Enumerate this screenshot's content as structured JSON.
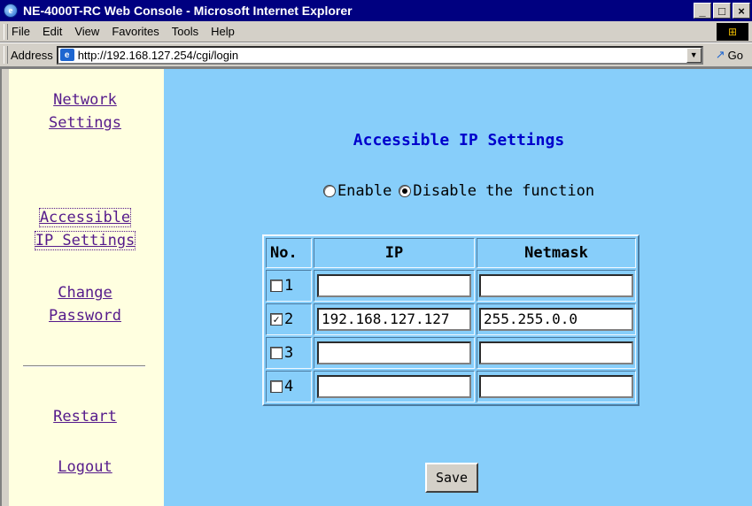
{
  "window": {
    "title": "NE-4000T-RC Web Console - Microsoft Internet Explorer",
    "controls": [
      "_",
      "□",
      "×"
    ]
  },
  "menu": [
    "File",
    "Edit",
    "View",
    "Favorites",
    "Tools",
    "Help"
  ],
  "address": {
    "label": "Address",
    "url": "http://192.168.127.254/cgi/login",
    "go_label": "Go"
  },
  "sidebar": {
    "items": [
      {
        "line1": "Network",
        "line2": "Settings"
      },
      {
        "line1": "Accessible",
        "line2": "IP Settings"
      },
      {
        "line1": "Change",
        "line2": "Password"
      },
      {
        "line1": "Restart"
      },
      {
        "line1": "Logout"
      }
    ]
  },
  "main": {
    "heading": "Accessible IP Settings",
    "radio_enable": "Enable",
    "radio_disable": "Disable the function",
    "selected_option": "Disable the function",
    "table": {
      "headers": [
        "No.",
        "IP",
        "Netmask"
      ],
      "rows": [
        {
          "no": "1",
          "checked": false,
          "ip": "",
          "netmask": ""
        },
        {
          "no": "2",
          "checked": true,
          "ip": "192.168.127.127",
          "netmask": "255.255.0.0"
        },
        {
          "no": "3",
          "checked": false,
          "ip": "",
          "netmask": ""
        },
        {
          "no": "4",
          "checked": false,
          "ip": "",
          "netmask": ""
        }
      ]
    },
    "save_label": "Save"
  },
  "colors": {
    "sidebar_bg": "#ffffe0",
    "main_bg": "#87cefa",
    "heading": "#0000cc",
    "link": "#551a8b",
    "titlebar": "#000080"
  }
}
